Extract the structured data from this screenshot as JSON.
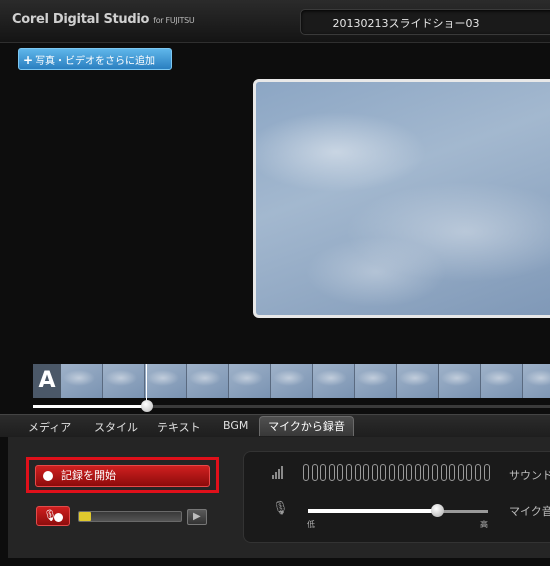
{
  "app": {
    "title": "Corel Digital Studio",
    "title_suffix": "for FUJITSU",
    "project_name": "20130213スライドショー03"
  },
  "toolbar": {
    "add_media_label": "写真・ビデオをさらに追加"
  },
  "timeline": {
    "title_clip_letter": "A",
    "playhead_fraction": 0.22
  },
  "tabs": {
    "items": [
      "メディア",
      "スタイル",
      "テキスト",
      "BGM",
      "マイクから録音"
    ],
    "active": "マイクから録音"
  },
  "record": {
    "start_label": "記録を開始",
    "input_level_fraction": 0.12
  },
  "mic_panel": {
    "sound_label": "サウンド",
    "mic_volume_label": "マイク音",
    "volume_low": "低",
    "volume_high": "高",
    "volume_fraction": 0.72,
    "meter_segments": 22
  },
  "colors": {
    "record_red": "#c41818",
    "highlight_frame": "#e0101a",
    "add_button_blue": "#3a95d4",
    "level_yellow": "#e0c92e"
  },
  "icons": {
    "add": "plus-icon",
    "record": "record-dot-icon",
    "mic_record": "microphone-record-icon",
    "play": "play-icon",
    "signal": "signal-bars-icon",
    "microphone": "microphone-icon"
  }
}
